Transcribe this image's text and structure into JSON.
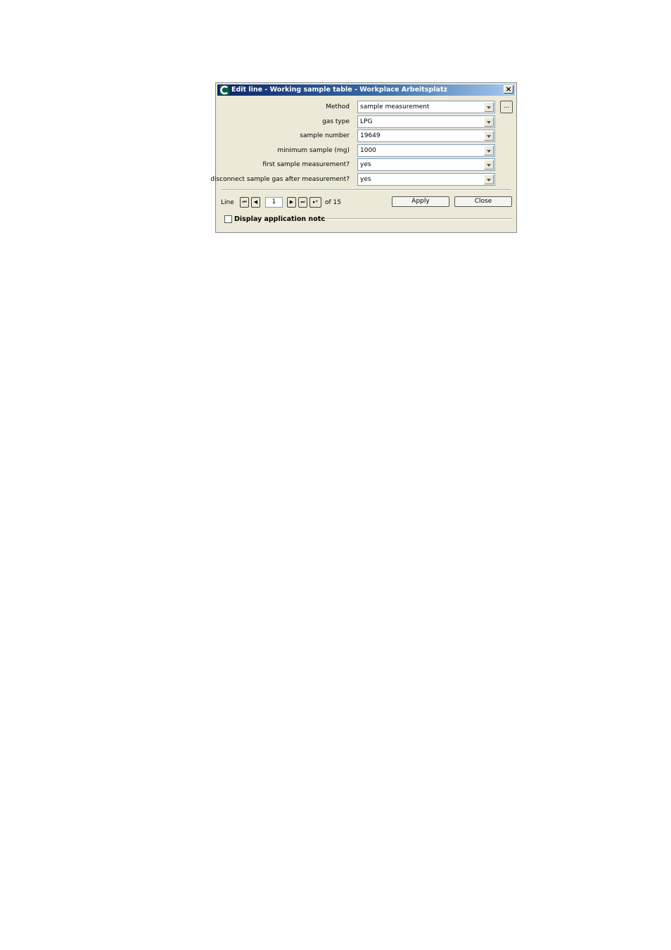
{
  "window": {
    "title": "Edit line - Working sample table - Workplace Arbeitsplatz",
    "close_label": "×"
  },
  "fields": [
    {
      "label": "Method",
      "value": "sample measurement"
    },
    {
      "label": "gas type",
      "value": "LPG"
    },
    {
      "label": "sample number",
      "value": "19649"
    },
    {
      "label": "minimum sample (mg)",
      "value": "1000"
    },
    {
      "label": "first sample measurement?",
      "value": "yes"
    },
    {
      "label": "disconnect sample gas after measurement?",
      "value": "yes"
    }
  ],
  "method_browse_label": "...",
  "navigation": {
    "line_label": "Line",
    "current_line": "1",
    "of_text": "of 15",
    "first_icon": "⏮",
    "prev_icon": "◀",
    "next_icon": "▶",
    "last_icon": "⏭",
    "new_icon": "▸*"
  },
  "buttons": {
    "apply": "Apply",
    "close": "Close"
  },
  "application_note": {
    "label": "Display application note",
    "checked": false
  },
  "colors": {
    "dialog_bg": "#ece9d8",
    "title_start": "#0a246a",
    "title_end": "#a6caf0"
  }
}
